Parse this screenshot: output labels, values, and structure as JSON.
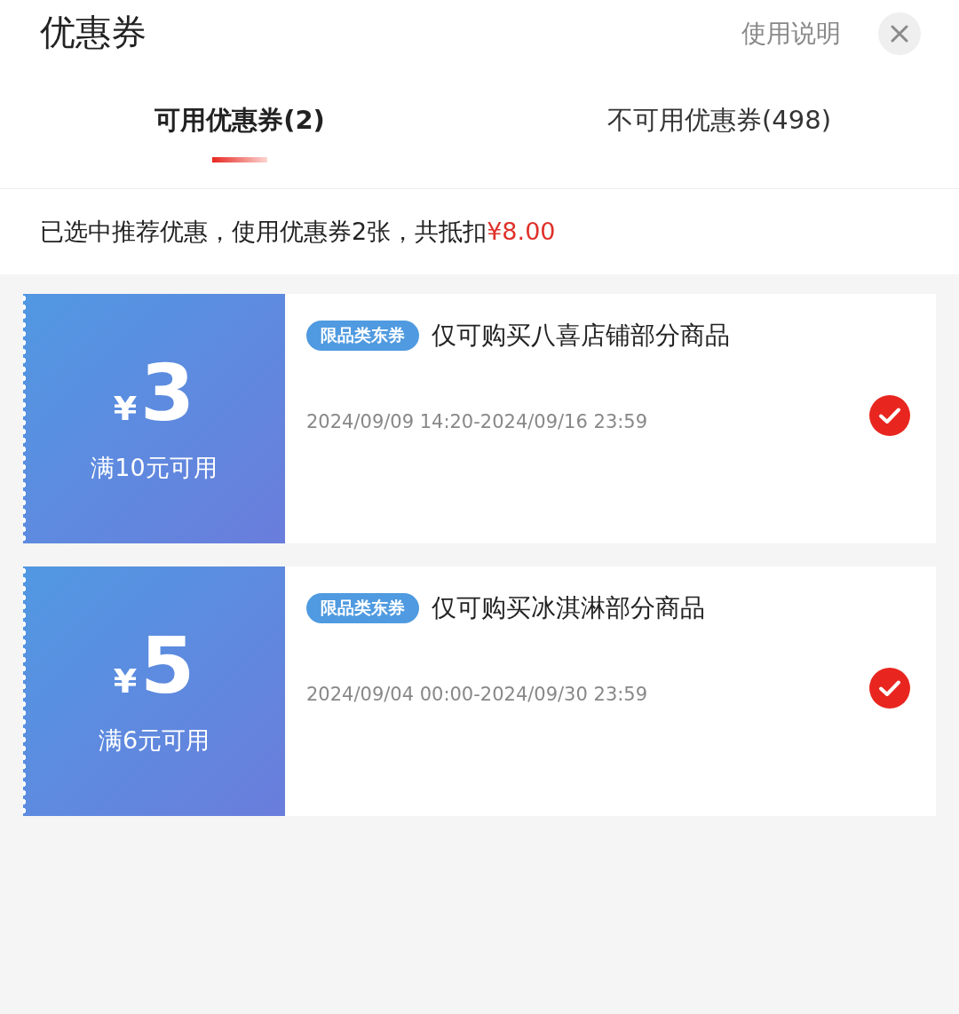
{
  "header": {
    "title": "优惠券",
    "help_link": "使用说明"
  },
  "tabs": [
    {
      "label": "可用优惠券(2)",
      "selected": true
    },
    {
      "label": "不可用优惠券(498)",
      "selected": false
    }
  ],
  "summary": {
    "text": "已选中推荐优惠，使用优惠券2张，共抵扣",
    "amount": "¥8.00"
  },
  "coupons": [
    {
      "currency": "¥",
      "value": "3",
      "condition": "满10元可用",
      "tag": "限品类东券",
      "title": "仅可购买八喜店铺部分商品",
      "period": "2024/09/09 14:20-2024/09/16 23:59",
      "selected": true
    },
    {
      "currency": "¥",
      "value": "5",
      "condition": "满6元可用",
      "tag": "限品类东券",
      "title": "仅可购买冰淇淋部分商品",
      "period": "2024/09/04 00:00-2024/09/30 23:59",
      "selected": true
    }
  ]
}
